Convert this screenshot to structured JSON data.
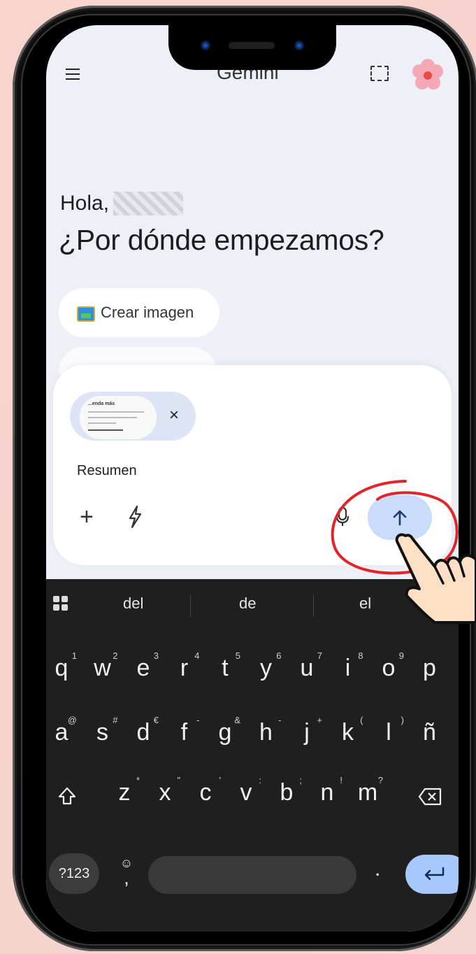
{
  "app": {
    "title": "Gemini"
  },
  "greeting": {
    "hello": "Hola,",
    "headline": "¿Por dónde empezamos?"
  },
  "chips": [
    {
      "label": "Crear imagen",
      "icon": "image-icon"
    }
  ],
  "composer": {
    "attachment": {
      "title": "...enda más",
      "close_label": "×"
    },
    "prompt_text": "Resumen",
    "icons": [
      "plus-icon",
      "bolt-icon",
      "mic-icon",
      "send-arrow-icon"
    ]
  },
  "keyboard": {
    "suggestions": [
      "del",
      "de",
      "el"
    ],
    "row1": [
      {
        "k": "q",
        "s": "1"
      },
      {
        "k": "w",
        "s": "2"
      },
      {
        "k": "e",
        "s": "3"
      },
      {
        "k": "r",
        "s": "4"
      },
      {
        "k": "t",
        "s": "5"
      },
      {
        "k": "y",
        "s": "6"
      },
      {
        "k": "u",
        "s": "7"
      },
      {
        "k": "i",
        "s": "8"
      },
      {
        "k": "o",
        "s": "9"
      },
      {
        "k": "p",
        "s": ""
      }
    ],
    "row2": [
      {
        "k": "a",
        "s": "@"
      },
      {
        "k": "s",
        "s": "#"
      },
      {
        "k": "d",
        "s": "€"
      },
      {
        "k": "f",
        "s": "-"
      },
      {
        "k": "g",
        "s": "&"
      },
      {
        "k": "h",
        "s": "-"
      },
      {
        "k": "j",
        "s": "+"
      },
      {
        "k": "k",
        "s": "("
      },
      {
        "k": "l",
        "s": ")"
      },
      {
        "k": "ñ",
        "s": ""
      }
    ],
    "row3": [
      {
        "k": "z",
        "s": "*"
      },
      {
        "k": "x",
        "s": "\""
      },
      {
        "k": "c",
        "s": "'"
      },
      {
        "k": "v",
        "s": ":"
      },
      {
        "k": "b",
        "s": ";"
      },
      {
        "k": "n",
        "s": "!"
      },
      {
        "k": "m",
        "s": "?"
      }
    ],
    "mode_key": "?123",
    "emoji_key": "☺",
    "comma_key": ",",
    "period_key": "."
  },
  "colors": {
    "send_bg": "#c9dcf9",
    "annotation_red": "#e0252b",
    "keyboard_bg": "#1f1f1f"
  }
}
